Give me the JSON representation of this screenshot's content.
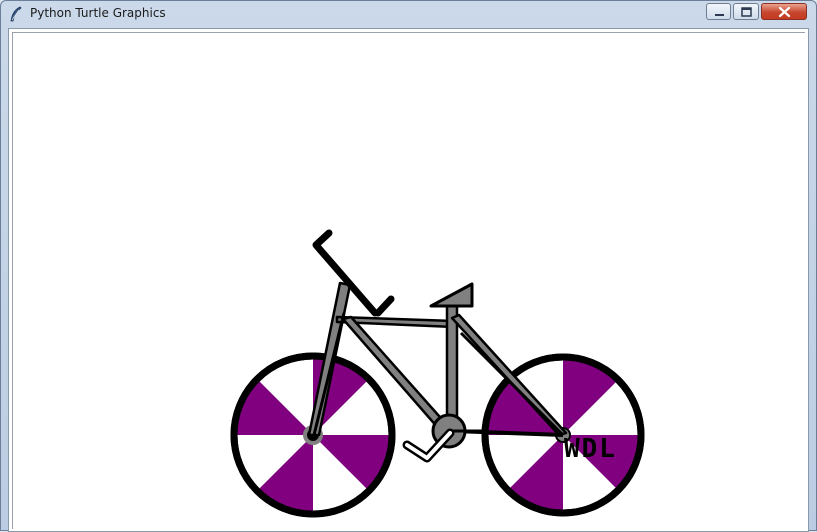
{
  "window": {
    "title": "Python Turtle Graphics",
    "icon": "feather-icon",
    "controls": [
      "minimize-icon",
      "maximize-icon",
      "close-icon"
    ]
  },
  "canvas": {
    "background": "#ffffff",
    "drawing": "bicycle",
    "label": "WDL",
    "colors": {
      "spoke_fill": "#800080",
      "frame": "#808080",
      "outline": "#000000",
      "hub": "#808080"
    }
  }
}
